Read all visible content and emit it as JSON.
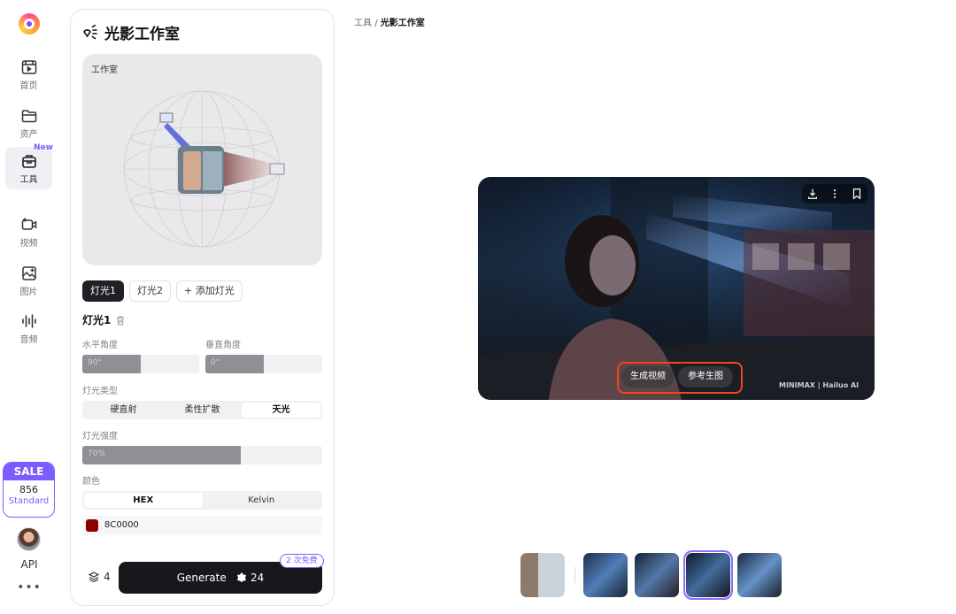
{
  "nav": {
    "items": [
      {
        "label": "首页",
        "icon": "film-icon"
      },
      {
        "label": "资产",
        "icon": "folder-icon"
      },
      {
        "label": "工具",
        "icon": "toolbox-icon",
        "badge": "New"
      },
      {
        "label": "视频",
        "icon": "video-add-icon"
      },
      {
        "label": "图片",
        "icon": "image-add-icon"
      },
      {
        "label": "音频",
        "icon": "audio-wave-icon"
      }
    ],
    "sale": {
      "title": "SALE",
      "count": "856",
      "plan": "Standard"
    },
    "api_label": "API",
    "more_label": "•••"
  },
  "panel": {
    "title": "光影工作室",
    "studio_label": "工作室",
    "light_tabs": [
      "灯光1",
      "灯光2",
      "+ 添加灯光"
    ],
    "active_light": "灯光1",
    "h_angle_label": "水平角度",
    "h_angle_value": "90°",
    "h_angle_fraction": 0.5,
    "v_angle_label": "垂直角度",
    "v_angle_value": "0°",
    "v_angle_fraction": 0.5,
    "light_type_label": "灯光类型",
    "light_types": [
      "硬直射",
      "柔性扩散",
      "天光"
    ],
    "light_type_selected": "天光",
    "intensity_label": "灯光强度",
    "intensity_value": "70%",
    "intensity_fraction": 0.66,
    "color_label": "颜色",
    "color_modes": [
      "HEX",
      "Kelvin"
    ],
    "color_mode_selected": "HEX",
    "color_hex": "8C0000",
    "color_swatch": "#8C0000",
    "layers_count": "4",
    "generate_label": "Generate",
    "generate_cost": "24",
    "free_badge": "2 次免费"
  },
  "breadcrumb": {
    "parent": "工具",
    "separator": "/",
    "current": "光影工作室"
  },
  "preview": {
    "buttons": [
      "生成视频",
      "参考生图"
    ],
    "brand_text": "MINIMAX | Hailuo AI"
  },
  "colors": {
    "accent": "#7b5cff",
    "highlight": "#f2441d",
    "dark": "#16181c"
  }
}
